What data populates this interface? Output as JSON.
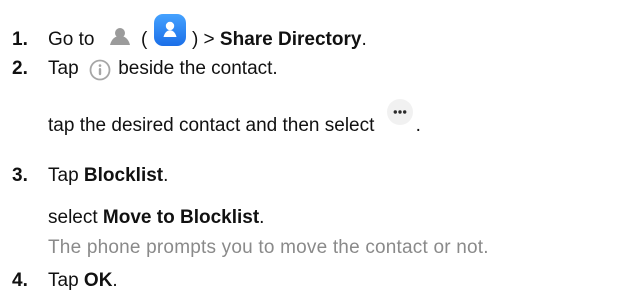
{
  "steps": [
    {
      "number": "1.",
      "parts": {
        "go_to": "Go to",
        "paren_open": "(",
        "paren_close_arrow": ") >",
        "target": "Share Directory",
        "period": "."
      },
      "icons": [
        "person-icon",
        "contacts-app-icon"
      ]
    },
    {
      "number": "2.",
      "parts": {
        "before": "Tap",
        "after": "beside the contact."
      },
      "icons": [
        "info-icon"
      ],
      "detail": {
        "before": "tap the desired contact and then select",
        "after": "."
      },
      "detail_icons": [
        "more-icon"
      ]
    },
    {
      "number": "3.",
      "parts": {
        "before": "Tap",
        "strong": "Blocklist",
        "after": "."
      },
      "detail": {
        "before": "select",
        "strong": "Move to Blocklist",
        "after": "."
      },
      "note": "The phone prompts you to move the contact or not."
    },
    {
      "number": "4.",
      "parts": {
        "before": "Tap",
        "strong": "OK",
        "after": "."
      }
    }
  ],
  "colors": {
    "text": "#111111",
    "muted": "#8a8a8a",
    "icon_gray": "#9b9b9b",
    "contacts_blue": "#2f86ff",
    "contacts_blue_dark": "#1b6fe8",
    "info_gray": "#a6a6a6",
    "more_bg": "#f1f1f1",
    "more_dots": "#2b2b2b"
  }
}
